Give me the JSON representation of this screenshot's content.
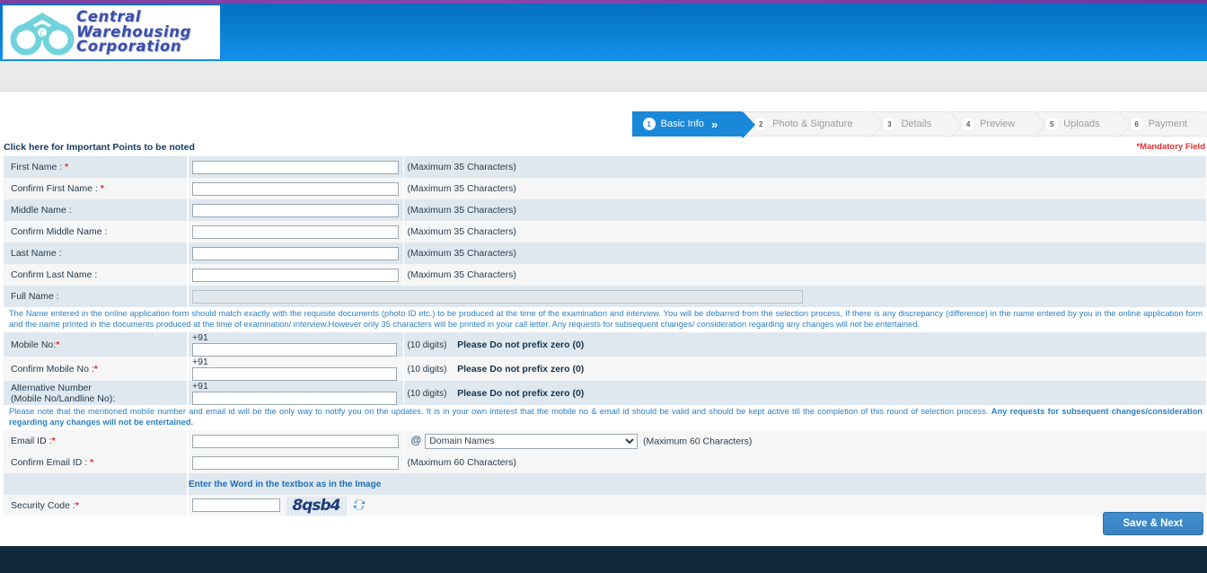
{
  "header": {
    "logo_line1": "Central",
    "logo_line2": "Warehousing",
    "logo_line3": "Corporation",
    "logo_icon": "warehouse-logo-icon"
  },
  "steps": [
    {
      "num": "1",
      "label": "Basic Info",
      "active": true
    },
    {
      "num": "2",
      "label": "Photo & Signature",
      "active": false
    },
    {
      "num": "3",
      "label": "Details",
      "active": false
    },
    {
      "num": "4",
      "label": "Preview",
      "active": false
    },
    {
      "num": "5",
      "label": "Uploads",
      "active": false
    },
    {
      "num": "6",
      "label": "Payment",
      "active": false
    }
  ],
  "info": {
    "click_here": "Click here for Important Points to be noted",
    "mandatory": "*Mandatory Field"
  },
  "hints": {
    "max35": "(Maximum 35 Characters)",
    "max60": "(Maximum 60 Characters)",
    "digits10": "(10 digits)",
    "no_zero": "Please Do not prefix zero (0)",
    "country_code": "+91",
    "at_symbol": "@"
  },
  "fields": {
    "first_name": "First Name : ",
    "confirm_first_name": "Confirm First Name : ",
    "middle_name": "Middle Name :",
    "confirm_middle_name": "Confirm Middle Name :",
    "last_name": "Last Name :",
    "confirm_last_name": "Confirm Last Name :",
    "full_name": "Full Name :",
    "mobile_no": "Mobile No:",
    "confirm_mobile_no": "Confirm Mobile No :",
    "alternative_number_l1": "Alternative Number",
    "alternative_number_l2": "(Mobile No/Landline No):",
    "email_id": "Email ID :",
    "confirm_email_id": "Confirm Email ID : ",
    "security_code": "Security Code :"
  },
  "values": {
    "first_name": "",
    "confirm_first_name": "",
    "middle_name": "",
    "confirm_middle_name": "",
    "last_name": "",
    "confirm_last_name": "",
    "full_name": "",
    "mobile_no": "",
    "confirm_mobile_no": "",
    "alternative_number": "",
    "email_id": "",
    "confirm_email_id": "",
    "security_code": ""
  },
  "domain_select": {
    "selected": "Domain Names"
  },
  "notes": {
    "name_note": "The Name entered in the online application form should match exactly with the requisite documents (photo ID etc.) to be produced at the time of the examination and interview. You will be debarred from the selection process, If there is any discrepancy (difference) in the name entered by you in the online application form and the name printed in the documents produced at the time of examination/ interview.However only 35 characters will be printed in your call letter. Any requests for subsequent changes/ consideration regarding any changes will not be entertained.",
    "contact_note_normal": "Please note that the mentioned mobile number and email id will be the only way to notify you on the updates. It is in your own interest that the mobile no & email id should be valid and should be kept active till the completion of this round of selection process. ",
    "contact_note_bold": "Any requests for subsequent changes/consideration regarding any changes will not be entertained."
  },
  "captcha": {
    "instruction": "Enter the Word in the textbox as in the Image",
    "code_text": "8qsb4",
    "refresh_icon": "refresh-icon"
  },
  "actions": {
    "save_next": "Save & Next"
  },
  "colors": {
    "accent_blue": "#1a88d9",
    "note_blue": "#2b7fc4",
    "mandatory_red": "#e03030",
    "footer_navy": "#10293d"
  }
}
